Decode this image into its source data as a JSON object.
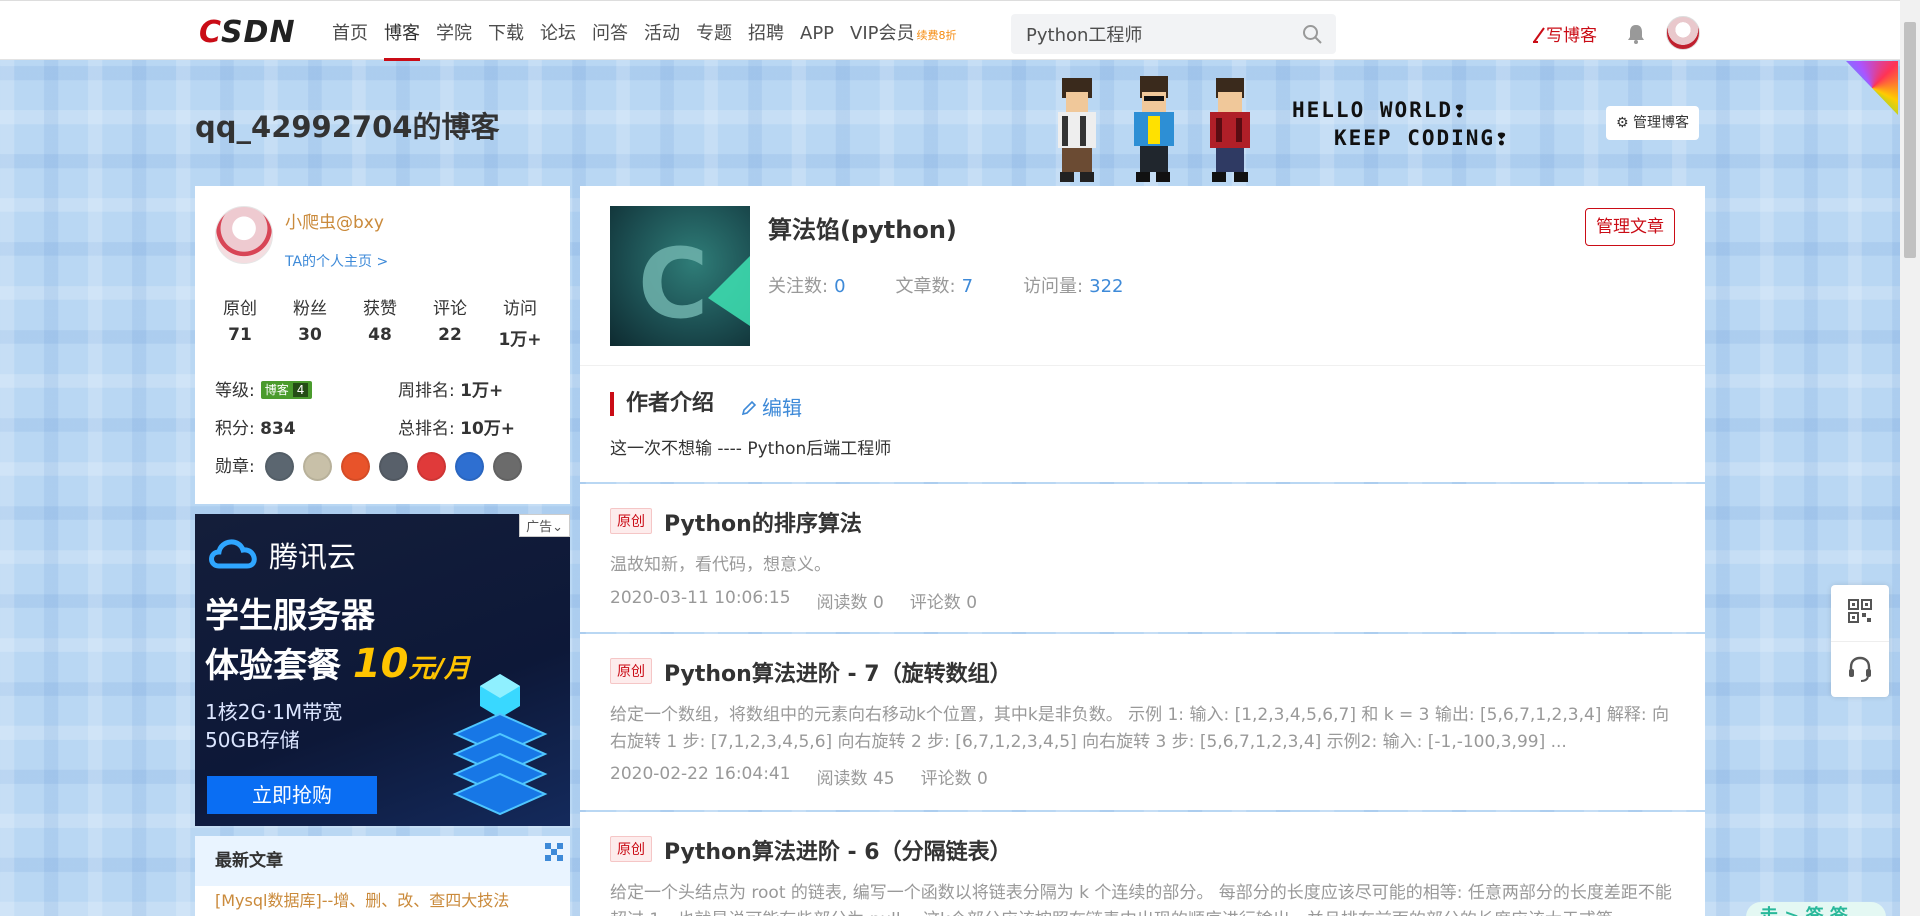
{
  "colors": {
    "brand": "#ca0c16",
    "link": "#3e8ad8",
    "gold": "#ca8a3b"
  },
  "topnav": {
    "logo_c": "C",
    "logo_rest": "SDN",
    "links": [
      {
        "label": "首页"
      },
      {
        "label": "博客"
      },
      {
        "label": "学院"
      },
      {
        "label": "下载"
      },
      {
        "label": "论坛"
      },
      {
        "label": "问答"
      },
      {
        "label": "活动"
      },
      {
        "label": "专题"
      },
      {
        "label": "招聘"
      },
      {
        "label": "APP"
      },
      {
        "label": "VIP会员"
      }
    ],
    "active_index": 1,
    "vip_badge": "续费8折",
    "search_value": "Python工程师",
    "write_blog": "写博客",
    "icons": [
      "search-icon",
      "bell-icon",
      "pen-icon"
    ]
  },
  "header": {
    "blog_title": "qq_42992704的博客",
    "hello_line1": "HELLO WORLD❢",
    "hello_line2": "KEEP CODING❢",
    "manage_blog": "管理博客"
  },
  "profile": {
    "name": "小爬虫@bxy",
    "home_link": "TA的个人主页 >",
    "stats": [
      {
        "label": "原创",
        "value": "71"
      },
      {
        "label": "粉丝",
        "value": "30"
      },
      {
        "label": "获赞",
        "value": "48"
      },
      {
        "label": "评论",
        "value": "22"
      },
      {
        "label": "访问",
        "value": "1万+"
      }
    ],
    "level_label": "等级:",
    "level_badge": "博客",
    "level_num": "4",
    "weekly_label": "周排名:",
    "weekly_value": "1万+",
    "points_label": "积分:",
    "points_value": "834",
    "total_label": "总排名:",
    "total_value": "10万+",
    "medals_label": "勋章:",
    "medal_colors": [
      "#5b6670",
      "#c8c0a8",
      "#e8532a",
      "#58606a",
      "#e03a3a",
      "#2e6fd1",
      "#6b6b6b"
    ]
  },
  "ad": {
    "tag": "广告",
    "brand": "腾讯云",
    "line1": "学生服务器",
    "line2_prefix": "体验套餐",
    "price": "10",
    "unit": "元/月",
    "spec1": "1核2G·1M带宽",
    "spec2": "50GB存储",
    "button": "立即抢购"
  },
  "recent": {
    "title": "最新文章",
    "first_item": "[Mysql数据库]--增、删、改、查四大技法"
  },
  "column": {
    "title": "算法馅(python)",
    "follow_label": "关注数:",
    "follow_value": "0",
    "articles_label": "文章数:",
    "articles_value": "7",
    "visits_label": "访问量:",
    "visits_value": "322",
    "manage_articles": "管理文章"
  },
  "author": {
    "title": "作者介绍",
    "edit": "编辑",
    "bio": "这一次不想输 ---- Python后端工程师"
  },
  "articles": [
    {
      "tag": "原创",
      "title": "Python的排序算法",
      "summary": "温故知新，看代码，想意义。",
      "date": "2020-03-11 10:06:15",
      "reads": "阅读数 0",
      "comments": "评论数 0"
    },
    {
      "tag": "原创",
      "title": "Python算法进阶 - 7（旋转数组）",
      "summary": "给定一个数组，将数组中的元素向右移动k个位置，其中k是非负数。 示例 1: 输入: [1,2,3,4,5,6,7] 和 k = 3 输出: [5,6,7,1,2,3,4] 解释: 向右旋转 1 步: [7,1,2,3,4,5,6] 向右旋转 2 步: [6,7,1,2,3,4,5] 向右旋转 3 步: [5,6,7,1,2,3,4] 示例2: 输入: [-1,-100,3,99] ...",
      "date": "2020-02-22 16:04:41",
      "reads": "阅读数 45",
      "comments": "评论数 0"
    },
    {
      "tag": "原创",
      "title": "Python算法进阶 - 6（分隔链表）",
      "summary": "给定一个头结点为 root 的链表, 编写一个函数以将链表分隔为 k 个连续的部分。 每部分的长度应该尽可能的相等: 任意两部分的长度差距不能超过 1，也就是说可能有些部分为 null。 这k个部分应该按照在链表中出现的顺序进行输出，并且排在前面的部分的长度应该大于或等"
    }
  ],
  "side": {
    "icons": [
      "qr-code-icon",
      "headset-icon"
    ],
    "float_text": "走 > 签 签"
  }
}
